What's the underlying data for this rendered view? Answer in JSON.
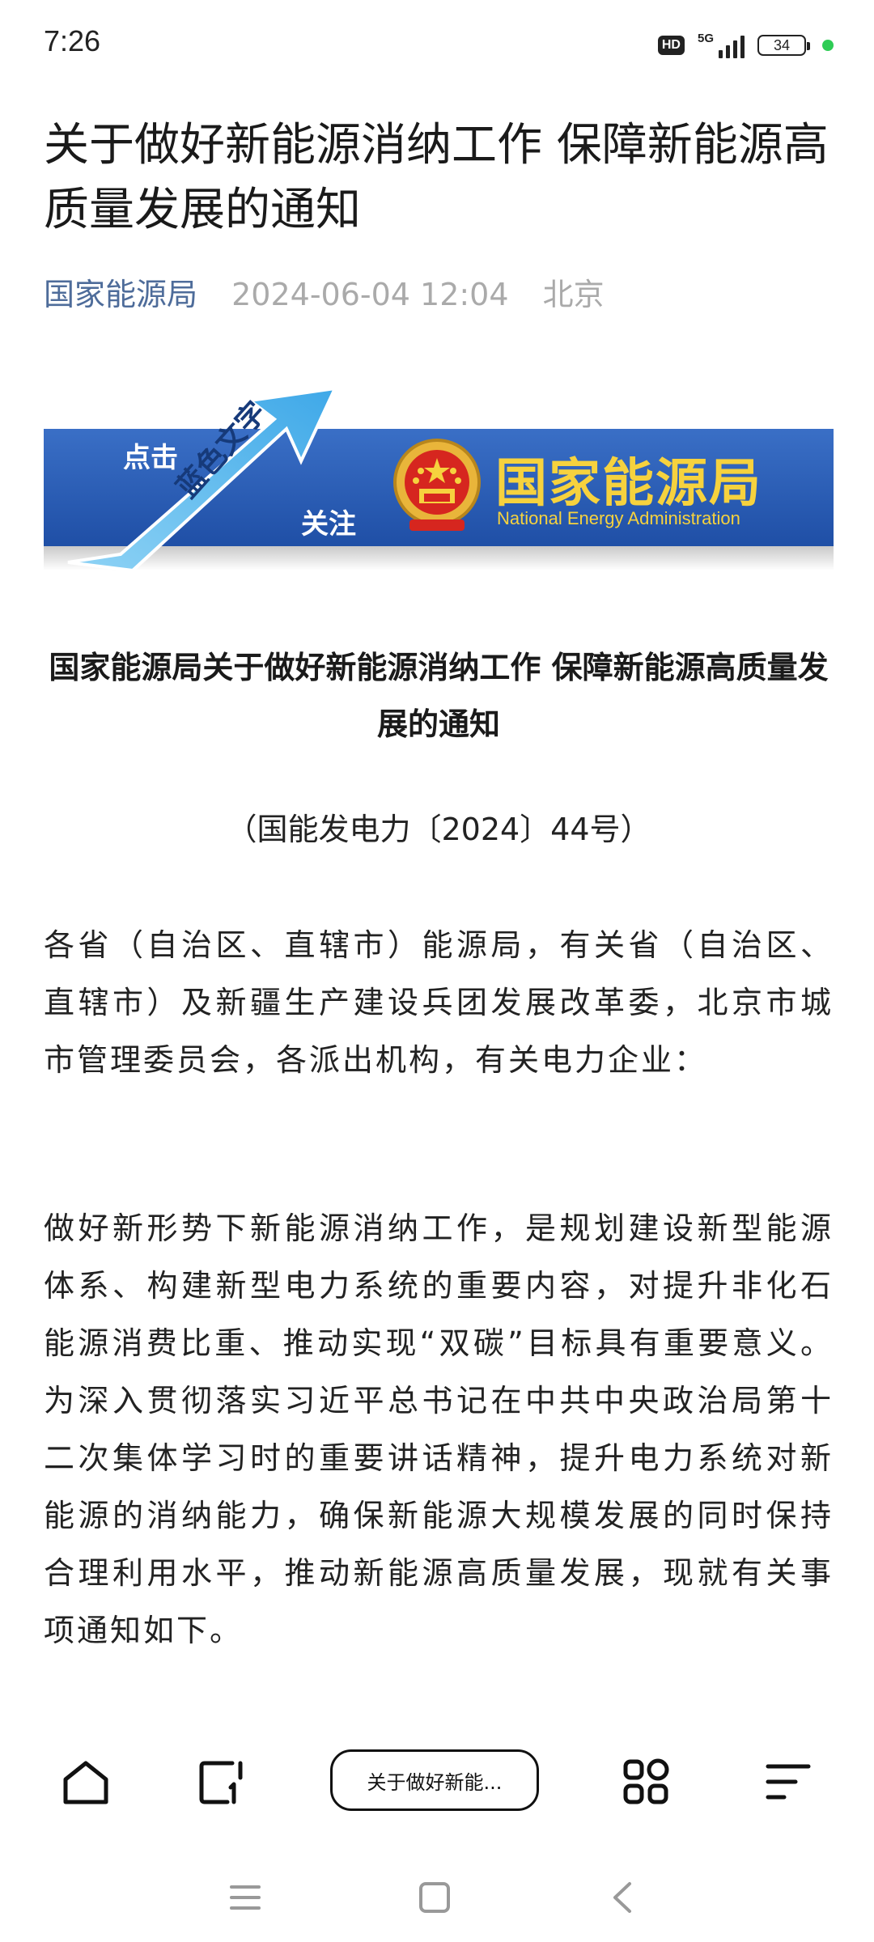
{
  "status_bar": {
    "time": "7:26",
    "hd": "HD",
    "network": "5G",
    "battery": "34"
  },
  "article": {
    "headline": "关于做好新能源消纳工作 保障新能源高质量发展的通知",
    "source": "国家能源局",
    "date": "2024-06-04 12:04",
    "location": "北京"
  },
  "banner": {
    "click": "点击",
    "blue_text": "蓝色文字",
    "follow": "关注",
    "agency_name": "国家能源局",
    "agency_name_en": "National Energy Administration"
  },
  "body": {
    "doc_title": "国家能源局关于做好新能源消纳工作 保障新能源高质量发展的通知",
    "doc_number": "（国能发电力〔2024〕44号）",
    "para1": "各省（自治区、直辖市）能源局，有关省（自治区、直辖市）及新疆生产建设兵团发展改革委，北京市城市管理委员会，各派出机构，有关电力企业：",
    "para2": "做好新形势下新能源消纳工作，是规划建设新型能源体系、构建新型电力系统的重要内容，对提升非化石能源消费比重、推动实现“双碳”目标具有重要意义。为深入贯彻落实习近平总书记在中共中央政治局第十二次集体学习时的重要讲话精神，提升电力系统对新能源的消纳能力，确保新能源大规模发展的同时保持合理利用水平，推动新能源高质量发展，现就有关事项通知如下。"
  },
  "toolbar": {
    "tab_title": "关于做好新能..."
  },
  "colors": {
    "source_link": "#4e6c9a",
    "meta_gray": "#aaaaaa",
    "banner_blue": "#2a5cb6",
    "banner_gold": "#f6d23e",
    "status_dot": "#2ecc55"
  },
  "icons": {
    "toolbar": [
      "home-icon",
      "new-tab-icon",
      "grid-icon",
      "menu-icon"
    ],
    "navbar": [
      "recent-apps-icon",
      "home-square-icon",
      "back-icon"
    ]
  }
}
